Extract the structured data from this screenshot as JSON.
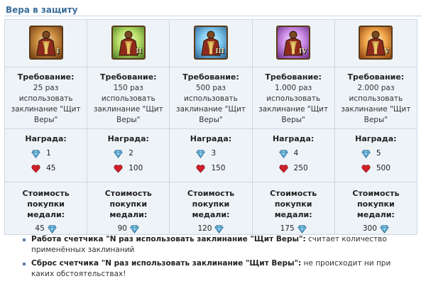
{
  "section": {
    "title": "Вера в защиту"
  },
  "labels": {
    "requirement": "Требование:",
    "reward": "Награда:",
    "cost": "Стоимость покупки медали:"
  },
  "icons": {
    "medal": "knight-medal-icon",
    "gem": "diamond-icon",
    "heart": "heart-icon"
  },
  "colors": {
    "title": "#3b6e9c",
    "heart": "#d0202a",
    "gem": "#4aa8d8"
  },
  "medals": [
    {
      "numeral": "I",
      "requirement": "25 раз использовать заклинание \"Щит Веры\"",
      "gems": "1",
      "hearts": "45",
      "cost": "45"
    },
    {
      "numeral": "II",
      "requirement": "150 раз использовать заклинание \"Щит Веры\"",
      "gems": "2",
      "hearts": "100",
      "cost": "90"
    },
    {
      "numeral": "III",
      "requirement": "500 раз использовать заклинание \"Щит Веры\"",
      "gems": "3",
      "hearts": "150",
      "cost": "120"
    },
    {
      "numeral": "IV",
      "requirement": "1.000 раз использовать заклинание \"Щит Веры\"",
      "gems": "4",
      "hearts": "250",
      "cost": "175"
    },
    {
      "numeral": "V",
      "requirement": "2.000 раз использовать заклинание \"Щит Веры\"",
      "gems": "5",
      "hearts": "500",
      "cost": "300"
    }
  ],
  "notes": [
    {
      "strong": "Работа счетчика \"N раз использовать заклинание \"Щит Веры\":",
      "text": " считает количество применённых заклинаний"
    },
    {
      "strong": "Сброс счетчика \"N раз использовать заклинание \"Щит Веры\":",
      "text": " не происходит ни при каких обстоятельствах!"
    }
  ]
}
